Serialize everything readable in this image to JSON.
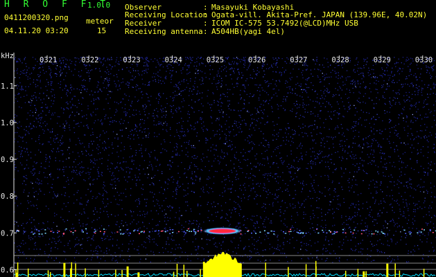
{
  "header": {
    "app_title": "H R O F F T",
    "app_version": "1.0.0",
    "file_name": "0411200320.png",
    "datetime": "04.11.20 03:20",
    "meteor_label": "meteor",
    "meteor_count": "15",
    "fields": [
      {
        "label": "Observer",
        "sep": ":",
        "value": "Masayuki Kobayashi"
      },
      {
        "label": "Receiving Location",
        "sep": ":",
        "value": "Ogata-vill. Akita-Pref. JAPAN (139.96E, 40.02N)"
      },
      {
        "label": "Receiver",
        "sep": ":",
        "value": "ICOM IC-575 53.7492(@LCD)MHz USB"
      },
      {
        "label": "Receiving antenna",
        "sep": ":",
        "value": "A504HB(yagi 4el)"
      }
    ]
  },
  "colors": {
    "background": "#000000",
    "spectrogram_noise": "#1a1f8c",
    "echo_core": "#ff2a3a",
    "echo_halo": "#4fd3ff",
    "yellow_trace": "#ffff00",
    "cyan_trace": "#00e0ff",
    "text_green": "#33ff33",
    "text_yellow": "#ffff33",
    "text_white": "#e8e8e8"
  },
  "chart_data": {
    "type": "heatmap",
    "ylabel": "kHz",
    "ylim": [
      0.58,
      1.19
    ],
    "yticks": [
      "1.1",
      "1.0",
      "0.9",
      "0.8",
      "0.7",
      "0.6"
    ],
    "ytick_values": [
      1.1,
      1.0,
      0.9,
      0.8,
      0.7,
      0.6
    ],
    "x_categories": [
      "0321",
      "0322",
      "0323",
      "0324",
      "0325",
      "0326",
      "0327",
      "0328",
      "0329",
      "0330"
    ],
    "echo_band_khz": 0.705,
    "meteor_echoes": [
      {
        "time": "0325",
        "frequency_khz": 0.705,
        "strength": "strong"
      }
    ],
    "grid": false
  }
}
